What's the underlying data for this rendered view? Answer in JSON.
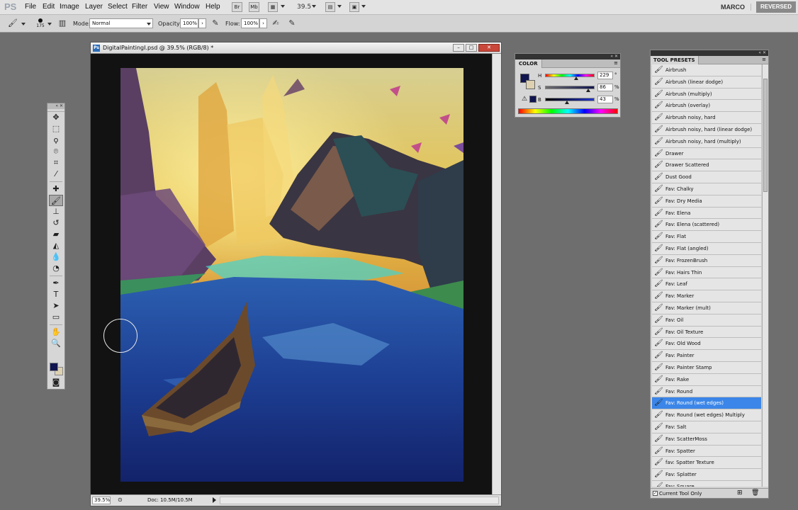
{
  "menubar": {
    "logo": "PS",
    "items": [
      "File",
      "Edit",
      "Image",
      "Layer",
      "Select",
      "Filter",
      "View",
      "Window",
      "Help"
    ],
    "btn_br": "Br",
    "btn_mb": "Mb",
    "zoom": "39.5",
    "workspace_user": "MARCO",
    "workspace_active": "REVERSED"
  },
  "options": {
    "brush_size": "175",
    "mode_label": "Mode:",
    "mode_value": "Normal",
    "opacity_label": "Opacity:",
    "opacity_value": "100%",
    "flow_label": "Flow:",
    "flow_value": "100%"
  },
  "document": {
    "title": "DigitalPaintingI.psd @ 39.5% (RGB/8) *",
    "status_zoom": "39.5%",
    "status_doc": "Doc: 10.5M/10.5M"
  },
  "color_panel": {
    "tab": "COLOR",
    "h_label": "H",
    "h_value": "229",
    "h_unit": "°",
    "s_label": "S",
    "s_value": "86",
    "s_unit": "%",
    "b_label": "B",
    "b_value": "43",
    "b_unit": "%",
    "fg_color": "#10154f",
    "bg_color": "#ddd1b1"
  },
  "tool_presets": {
    "tab": "TOOL PRESETS",
    "items": [
      "Airbrush",
      "Airbrush (linear dodge)",
      "Airbrush (multiply)",
      "Airbrush (overlay)",
      "Airbrush noisy, hard",
      "Airbrush noisy, hard (linear dodge)",
      "Airbrush noisy, hard (multiply)",
      "Drawer",
      "Drawer Scattered",
      "Dust Good",
      "Fav: Chalky",
      "Fav: Dry Media",
      "Fav: Elena",
      "Fav: Elena (scattered)",
      "Fav: Flat",
      "Fav: Flat (angled)",
      "Fav: FrozenBrush",
      "Fav: Hairs Thin",
      "Fav: Leaf",
      "Fav: Marker",
      "Fav: Marker (mult)",
      "Fav: Oil",
      "Fav: Oil Texture",
      "Fav: Old Wood",
      "Fav: Painter",
      "Fav: Painter Stamp",
      "Fav: Rake",
      "Fav: Round",
      "Fav: Round (wet edges)",
      "Fav: Round (wet edges) Multiply",
      "Fav: Salt",
      "Fav: ScatterMoss",
      "Fav: Spatter",
      "fav: Spatter Texture",
      "Fav: Splatter",
      "Fav: Square"
    ],
    "selected_index": 28,
    "footer_label": "Current Tool Only"
  }
}
